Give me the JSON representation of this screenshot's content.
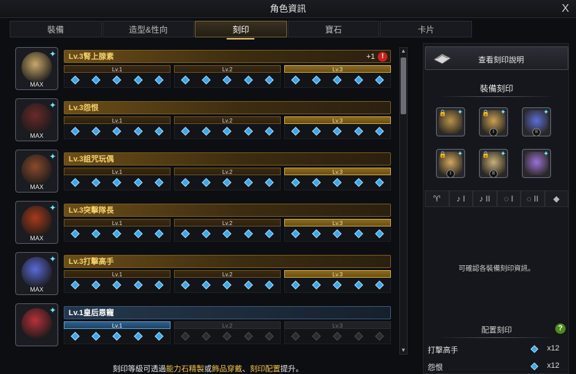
{
  "window": {
    "title": "角色資訊",
    "close": "X"
  },
  "tabs": [
    {
      "label": "裝備"
    },
    {
      "label": "造型&性向"
    },
    {
      "label": "刻印"
    },
    {
      "label": "寶石"
    },
    {
      "label": "卡片"
    }
  ],
  "engravings": [
    {
      "name": "Lv.3腎上腺素",
      "badge": "MAX",
      "plus": "+1",
      "warn": "!",
      "level": 3,
      "theme": "gold",
      "portrait_color": "#c9a86a",
      "levels": [
        {
          "label": "Lv.1",
          "filled": 5
        },
        {
          "label": "Lv.2",
          "filled": 5
        },
        {
          "label": "Lv.3",
          "filled": 5
        }
      ]
    },
    {
      "name": "Lv.3怨恨",
      "badge": "MAX",
      "level": 3,
      "theme": "gold",
      "portrait_color": "#6a2a2a",
      "levels": [
        {
          "label": "Lv.1",
          "filled": 5
        },
        {
          "label": "Lv.2",
          "filled": 5
        },
        {
          "label": "Lv.3",
          "filled": 5
        }
      ]
    },
    {
      "name": "Lv.3詛咒玩偶",
      "badge": "MAX",
      "level": 3,
      "theme": "gold",
      "portrait_color": "#8a4a2c",
      "levels": [
        {
          "label": "Lv.1",
          "filled": 5
        },
        {
          "label": "Lv.2",
          "filled": 5
        },
        {
          "label": "Lv.3",
          "filled": 5
        }
      ]
    },
    {
      "name": "Lv.3突擊隊長",
      "badge": "MAX",
      "level": 3,
      "theme": "gold",
      "portrait_color": "#a83a1a",
      "levels": [
        {
          "label": "Lv.1",
          "filled": 5
        },
        {
          "label": "Lv.2",
          "filled": 5
        },
        {
          "label": "Lv.3",
          "filled": 5
        }
      ]
    },
    {
      "name": "Lv.3打擊高手",
      "badge": "MAX",
      "level": 3,
      "theme": "gold",
      "portrait_color": "#5a6ad8",
      "levels": [
        {
          "label": "Lv.1",
          "filled": 5
        },
        {
          "label": "Lv.2",
          "filled": 5
        },
        {
          "label": "Lv.3",
          "filled": 5
        }
      ]
    },
    {
      "name": "Lv.1皇后恩寵",
      "badge": "",
      "level": 1,
      "theme": "blue",
      "portrait_color": "#b8303a",
      "levels": [
        {
          "label": "Lv.1",
          "filled": 5
        },
        {
          "label": "Lv.2",
          "filled": 0
        },
        {
          "label": "Lv.3",
          "filled": 0
        }
      ]
    }
  ],
  "footer": {
    "prefix": "刻印等級可透過",
    "h1": "能力石精製",
    "mid1": "或",
    "h2": "飾品穿戴",
    "mid2": "、",
    "h3": "刻印配置",
    "suffix": "提升。"
  },
  "side": {
    "desc_button": "查看刻印說明",
    "equip_title": "裝備刻印",
    "accessories": [
      {
        "icon": "necklace-icon",
        "color": "#b8934a",
        "locked": true,
        "roman": ""
      },
      {
        "icon": "earring-icon",
        "color": "#c9a056",
        "locked": true,
        "roman": "I"
      },
      {
        "icon": "earring-icon",
        "color": "#5a6fd8",
        "locked": false,
        "roman": "II"
      },
      {
        "icon": "ring-icon",
        "color": "#d2a860",
        "locked": true,
        "roman": "I"
      },
      {
        "icon": "ring-icon",
        "color": "#c7b07a",
        "locked": true,
        "roman": "II"
      },
      {
        "icon": "stone-icon",
        "color": "#9a72d8",
        "locked": false,
        "roman": ""
      }
    ],
    "slots": [
      {
        "icon": "necklace-slot-icon",
        "glyph": "♈"
      },
      {
        "icon": "earring-1-slot-icon",
        "glyph": "♪ I"
      },
      {
        "icon": "earring-2-slot-icon",
        "glyph": "♪ II"
      },
      {
        "icon": "ring-1-slot-icon",
        "glyph": "◌ I"
      },
      {
        "icon": "ring-2-slot-icon",
        "glyph": "◌ II"
      },
      {
        "icon": "stone-slot-icon",
        "glyph": "◆"
      }
    ],
    "info_text": "可確認各裝備刻印資訊。",
    "config_title": "配置刻印",
    "help": "?",
    "config": [
      {
        "name": "打擊高手",
        "count": "x12"
      },
      {
        "name": "怨恨",
        "count": "x12"
      }
    ]
  }
}
